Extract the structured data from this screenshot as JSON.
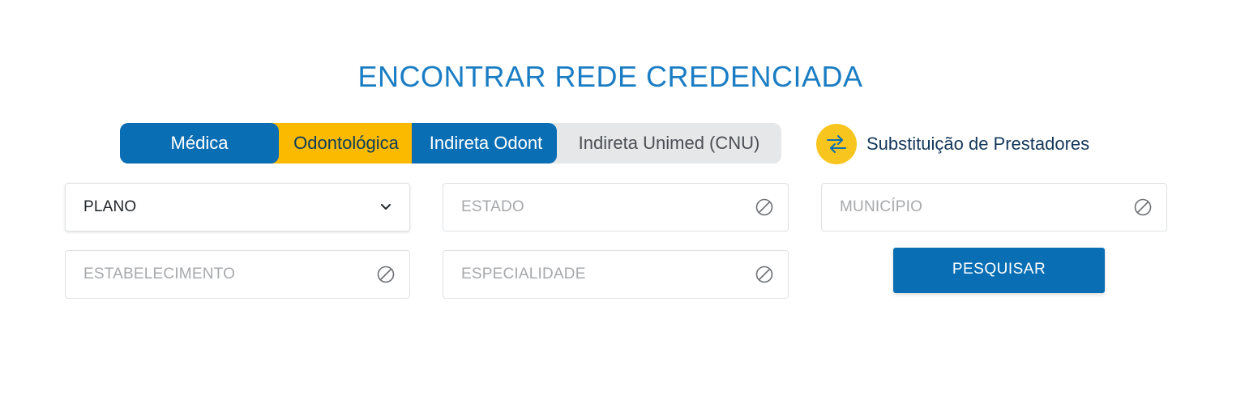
{
  "title": "ENCONTRAR REDE CREDENCIADA",
  "tabs": [
    {
      "label": "Médica"
    },
    {
      "label": "Odontológica"
    },
    {
      "label": "Indireta Odont"
    },
    {
      "label": "Indireta Unimed (CNU)"
    }
  ],
  "substituicao": {
    "label": "Substituição de Prestadores",
    "icon": "swap-arrows-icon"
  },
  "fields": {
    "plano": {
      "value": "PLANO",
      "icon": "chevron-down-icon"
    },
    "estado": {
      "placeholder": "ESTADO",
      "icon": "disabled-icon"
    },
    "municipio": {
      "placeholder": "MUNICÍPIO",
      "icon": "disabled-icon"
    },
    "estabelecimento": {
      "placeholder": "ESTABELECIMENTO",
      "icon": "disabled-icon"
    },
    "especialidade": {
      "placeholder": "ESPECIALIDADE",
      "icon": "disabled-icon"
    }
  },
  "search_button": {
    "label": "PESQUISAR"
  },
  "colors": {
    "primary": "#0a6eb4",
    "accent": "#fbb900",
    "icon_bg": "#f7c51d",
    "title": "#1a7dc4",
    "tab_bg": "#e6e7e8"
  }
}
